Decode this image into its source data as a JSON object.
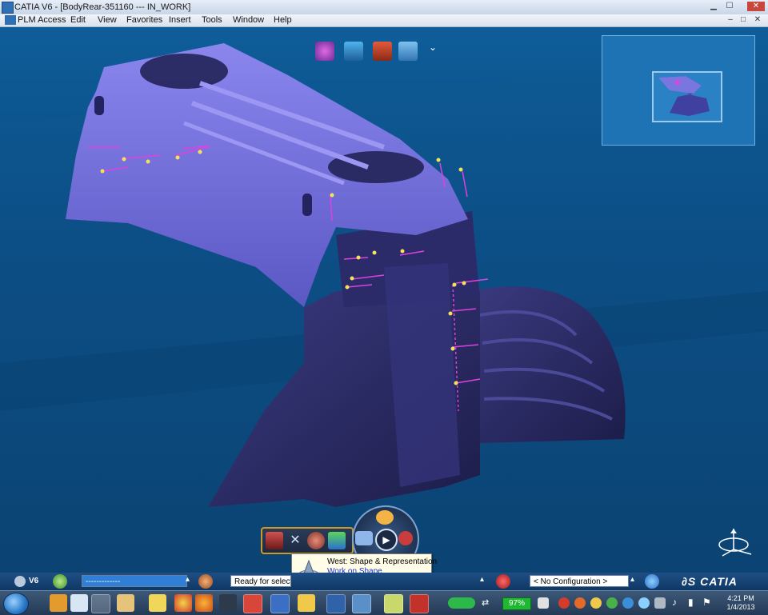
{
  "window": {
    "title": "CATIA V6 - [BodyRear-351160 --- IN_WORK]",
    "min": "▁",
    "max": "☐",
    "close": "✕"
  },
  "menu": {
    "items": [
      "PLM Access",
      "Edit",
      "View",
      "Favorites",
      "Insert",
      "Tools",
      "Window",
      "Help"
    ],
    "doc_min": "–",
    "doc_max": "□",
    "doc_close": "✕"
  },
  "tooltip": {
    "title": "West: Shape & Representation",
    "link": "Work on Shape"
  },
  "statusbar": {
    "v6_label": "V6",
    "selection_field": "-------------",
    "status_text": "Ready for selectio",
    "configuration": "< No Configuration >",
    "brand": "CATIA"
  },
  "taskbar": {
    "battery": "97%",
    "time": "4:21 PM",
    "date": "1/4/2013"
  },
  "colors": {
    "viewport_bg": "#0b4f88",
    "part_top": "#6a6ad8",
    "part_bottom": "#2a2a66",
    "annotation": "#e040e0",
    "toolbar_border": "#c99a2b"
  }
}
